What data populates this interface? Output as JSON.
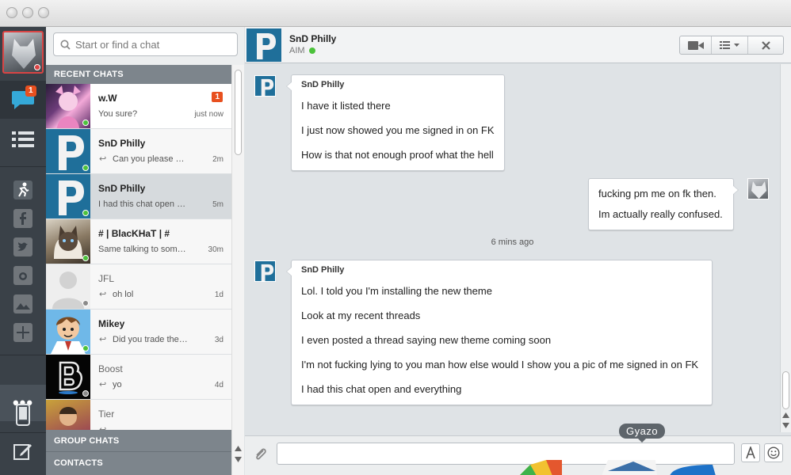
{
  "search": {
    "placeholder": "Start or find a chat"
  },
  "rail": {
    "notification_count": "1",
    "more_label": "•••"
  },
  "sections": {
    "recent": "RECENT CHATS",
    "group": "GROUP CHATS",
    "contacts": "CONTACTS"
  },
  "chats": [
    {
      "name": "w.W",
      "message": "You sure?",
      "time": "just now",
      "badge": "1",
      "reply": false,
      "status": "online",
      "status_color": "#4cc23b"
    },
    {
      "name": "SnD Philly",
      "message": "Can you please …",
      "time": "2m",
      "reply": true,
      "status": "online",
      "status_color": "#4cc23b"
    },
    {
      "name": "SnD Philly",
      "message": "I had this chat open …",
      "time": "5m",
      "reply": false,
      "status": "online",
      "status_color": "#4cc23b",
      "selected": true
    },
    {
      "name": "# | BlacKHaT | #",
      "message": "Same talking to som…",
      "time": "30m",
      "reply": false,
      "status": "online",
      "status_color": "#4cc23b"
    },
    {
      "name": "JFL",
      "message": "oh lol",
      "time": "1d",
      "reply": true,
      "status": "offline",
      "status_color": "#8a8a8a"
    },
    {
      "name": "Mikey",
      "message": "Did you trade the…",
      "time": "3d",
      "reply": true,
      "status": "online",
      "status_color": "#4cc23b"
    },
    {
      "name": "Boost",
      "message": "yo",
      "time": "4d",
      "reply": true,
      "status": "offline",
      "status_color": "#8a8a8a"
    },
    {
      "name": "Tier",
      "message": "",
      "time": "",
      "reply": true,
      "status": "offline",
      "status_color": "#8a8a8a"
    }
  ],
  "conversation": {
    "contact_name": "SnD Philly",
    "protocol": "AIM",
    "status_color": "#4cc23b"
  },
  "messages": {
    "group1": {
      "sender": "SnD Philly",
      "lines": [
        "I have it listed there",
        "I just now showed you me signed in on FK",
        "How is that not enough proof what the hell"
      ]
    },
    "group2": {
      "lines": [
        "fucking pm me on fk then.",
        "Im actually really confused."
      ]
    },
    "timestamp": "6 mins ago",
    "group3": {
      "sender": "SnD Philly",
      "lines": [
        "Lol. I told you I'm installing the new theme",
        "Look at my recent threads",
        "I even posted a thread saying new theme coming soon",
        "I'm not fucking lying to you man how else would I show you a pic of me signed in on FK",
        "I had this chat open and everything"
      ]
    }
  },
  "composer": {
    "tooltip": "Gyazo"
  },
  "colors": {
    "accent_badge": "#e8501f",
    "rail_bg": "#3a4148",
    "section_hdr": "#7d858c",
    "online": "#4cc23b"
  }
}
